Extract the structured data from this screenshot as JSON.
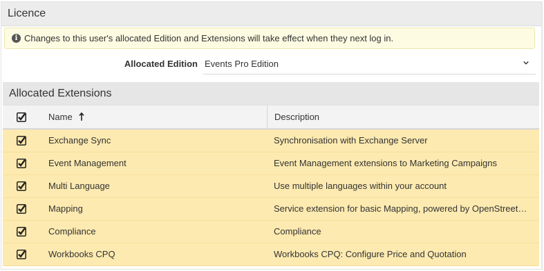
{
  "licence": {
    "title": "Licence",
    "notice": {
      "icon": "info-circle-icon",
      "text": "Changes to this user's allocated Edition and Extensions will take effect when they next log in."
    },
    "edition": {
      "label": "Allocated Edition",
      "value": "Events Pro Edition"
    }
  },
  "extensions": {
    "title": "Allocated Extensions",
    "columns": {
      "name": "Name",
      "description": "Description",
      "sort": "ascending"
    },
    "colors": {
      "selected_row": "#fdeab0",
      "header_bg": "#e6e6e6"
    },
    "rows": [
      {
        "checked": true,
        "name": "Exchange Sync",
        "description": "Synchronisation with Exchange Server"
      },
      {
        "checked": true,
        "name": "Event Management",
        "description": "Event Management extensions to Marketing Campaigns"
      },
      {
        "checked": true,
        "name": "Multi Language",
        "description": "Use multiple languages within your account"
      },
      {
        "checked": true,
        "name": "Mapping",
        "description": "Service extension for basic Mapping, powered by OpenStreetMap"
      },
      {
        "checked": true,
        "name": "Compliance",
        "description": "Compliance"
      },
      {
        "checked": true,
        "name": "Workbooks CPQ",
        "description": "Workbooks CPQ: Configure Price and Quotation"
      }
    ]
  }
}
